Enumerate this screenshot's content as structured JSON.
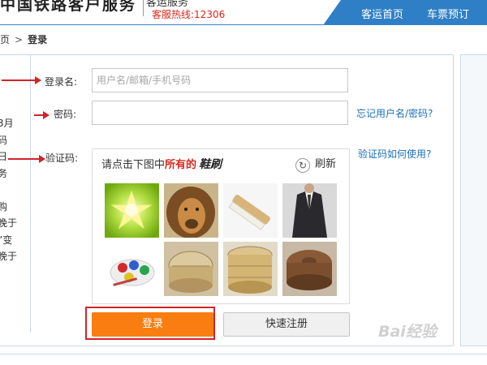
{
  "header": {
    "logo_text": "中国铁路客户服务",
    "service_text": "客运服务",
    "hotline": "客服热线:12306",
    "nav": [
      "客运首页",
      "车票预订"
    ],
    "nav_color": "#2f7fc6"
  },
  "breadcrumb": {
    "home": "页",
    "separator": ">",
    "current": "登录"
  },
  "sidebar": {
    "lines": [
      "3月",
      "码",
      "日",
      "务",
      "",
      "购",
      "晚于",
      "”变",
      "晚于"
    ]
  },
  "form": {
    "username": {
      "label": "登录名:",
      "placeholder": "用户名/邮箱/手机号码",
      "value": ""
    },
    "password": {
      "label": "密码:",
      "value": "",
      "forgot_link": "忘记用户名/密码?"
    },
    "captcha": {
      "label": "验证码:",
      "help_link": "验证码如何使用?"
    }
  },
  "captcha": {
    "instruction_prefix": "请点击下图中",
    "instruction_highlight": "所有的",
    "instruction_target": "鞋刷",
    "refresh_label": "刷新",
    "images": [
      "star-glow-image",
      "lion-image",
      "shoe-brush-image",
      "suit-image",
      "paint-palette-image",
      "bamboo-steamer-image",
      "steamer-stack-image",
      "wooden-steamer-image"
    ]
  },
  "buttons": {
    "login": "登录",
    "register": "快速注册"
  },
  "colors": {
    "accent": "#2f7fc6",
    "login_button": "#f97d10",
    "annotation_red": "#d0242c",
    "hotline_red": "#d9261c",
    "link_blue": "#1d6fb8"
  },
  "watermark": "Bai经验"
}
